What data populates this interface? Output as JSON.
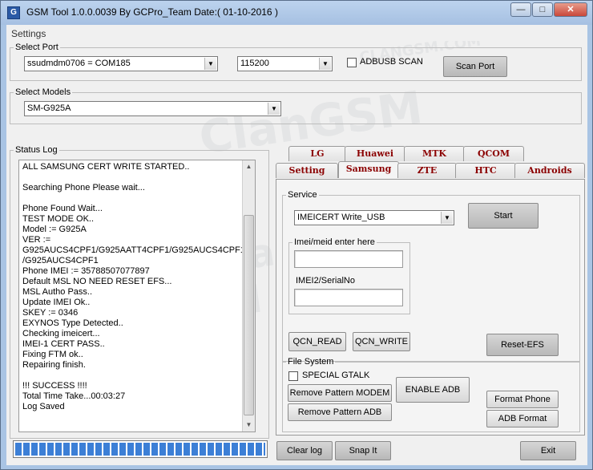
{
  "window": {
    "title": "GSM Tool 1.0.0.0039 By GCPro_Team  Date:( 01-10-2016 )",
    "controls": {
      "minimize": "—",
      "maximize": "□",
      "close": "✕"
    }
  },
  "menu": {
    "settings": "Settings"
  },
  "select_port": {
    "legend": "Select Port",
    "port": "ssudmdm0706 = COM185",
    "baud": "115200",
    "adbusb_label": "ADBUSB SCAN",
    "scan_button": "Scan Port"
  },
  "select_models": {
    "legend": "Select Models",
    "model": "SM-G925A"
  },
  "status_log": {
    "legend": "Status Log",
    "lines": [
      "ALL SAMSUNG CERT WRITE STARTED..",
      "",
      "Searching Phone Please wait...",
      "",
      "Phone Found Wait...",
      "TEST MODE OK..",
      "Model := G925A",
      "VER :=",
      "G925AUCS4CPF1/G925AATT4CPF1/G925AUCS4CPF1",
      "/G925AUCS4CPF1",
      "Phone IMEI := 35788507077897",
      "Default MSL NO NEED RESET EFS...",
      "MSL Autho Pass..",
      "Update IMEI Ok..",
      "SKEY := 0346",
      "EXYNOS Type Detected..",
      "Checking imeicert...",
      "IMEI-1 CERT PASS..",
      "Fixing FTM ok..",
      "Repairing finish.",
      "",
      "!!! SUCCESS !!!!",
      "Total Time Take...00:03:27",
      "Log Saved"
    ],
    "progress_percent": 100
  },
  "tabs": {
    "row_back": [
      "LG",
      "Huawei",
      "MTK",
      "QCOM"
    ],
    "row_front": [
      "Setting",
      "Samsung",
      "ZTE",
      "HTC",
      "Androids"
    ],
    "active": "Samsung"
  },
  "service": {
    "legend": "Service",
    "selected": "IMEICERT Write_USB",
    "start_button": "Start",
    "imei_group_legend": "Imei/meid enter here",
    "imei2_label": "IMEI2/SerialNo",
    "imei1_value": "",
    "imei2_value": "",
    "qcn_read": "QCN_READ",
    "qcn_write": "QCN_WRITE",
    "reset_efs": "Reset-EFS"
  },
  "file_system": {
    "legend": "File System",
    "special_gtalk": "SPECIAL GTALK",
    "remove_pattern_modem": "Remove Pattern MODEM",
    "remove_pattern_adb": "Remove Pattern ADB",
    "enable_adb": "ENABLE ADB",
    "format_phone": "Format Phone",
    "adb_format": "ADB Format"
  },
  "bottom": {
    "clear_log": "Clear log",
    "snap_it": "Snap It",
    "exit": "Exit"
  },
  "watermark": {
    "big": "ClanGSM",
    "small": "CLANGSM.COM"
  }
}
